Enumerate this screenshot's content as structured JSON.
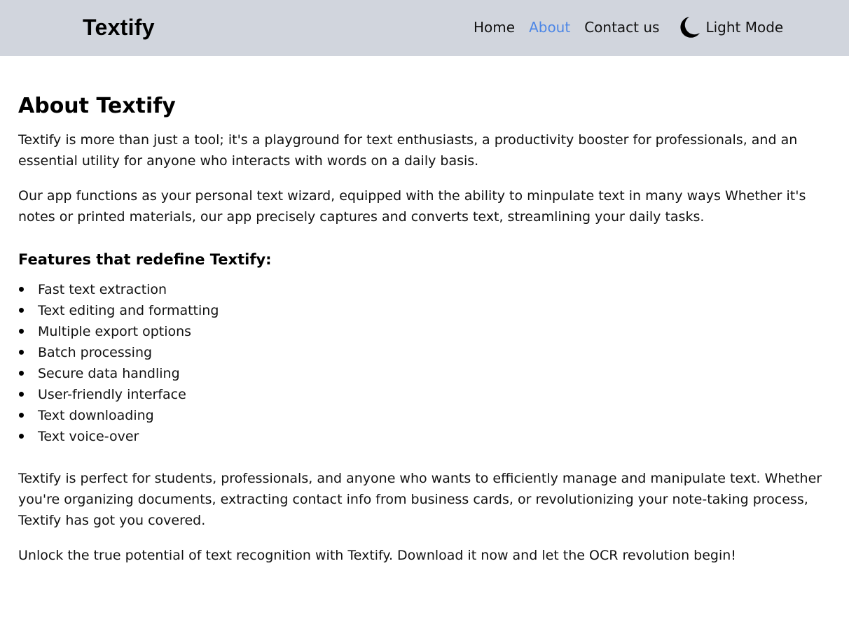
{
  "header": {
    "brand": "Textify",
    "nav": [
      {
        "label": "Home",
        "active": false
      },
      {
        "label": "About",
        "active": true
      },
      {
        "label": "Contact us",
        "active": false
      }
    ],
    "mode_toggle": {
      "icon": "moon-icon",
      "label": "Light Mode"
    },
    "colors": {
      "background": "#d1d5dd",
      "active_link": "#4c86e6"
    }
  },
  "main": {
    "title": "About Textify",
    "intro": [
      "Textify is more than just a tool; it's a playground for text enthusiasts, a productivity booster for professionals, and an essential utility for anyone who interacts with words on a daily basis.",
      "Our app functions as your personal text wizard, equipped with the ability to minpulate text in many ways Whether it's notes or printed materials, our app precisely captures and converts text, streamlining your daily tasks."
    ],
    "features_title": "Features that redefine Textify:",
    "features": [
      "Fast text extraction",
      "Text editing and formatting",
      "Multiple export options",
      "Batch processing",
      "Secure data handling",
      "User-friendly interface",
      "Text downloading",
      "Text voice-over"
    ],
    "outro": [
      "Textify is perfect for students, professionals, and anyone who wants to efficiently manage and manipulate text. Whether you're organizing documents, extracting contact info from business cards, or revolutionizing your note-taking process, Textify has got you covered.",
      "Unlock the true potential of text recognition with Textify. Download it now and let the OCR revolution begin!"
    ]
  }
}
